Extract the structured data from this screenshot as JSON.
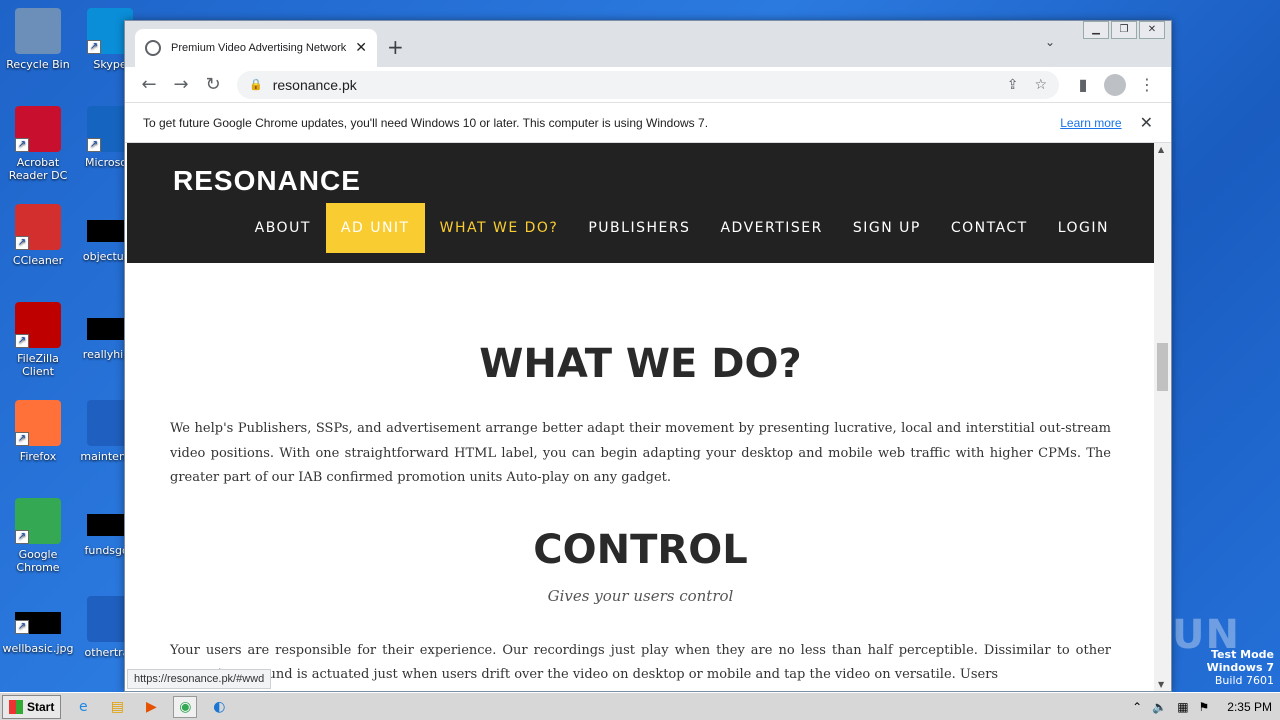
{
  "desktop": {
    "icons": [
      {
        "label": "Recycle Bin",
        "color": "#6b8fb8"
      },
      {
        "label": "Skype",
        "color": "#0a8ed8"
      },
      {
        "label": "Acrobat Reader DC",
        "color": "#c8102e"
      },
      {
        "label": "Microsoft",
        "color": "#1565c0"
      },
      {
        "label": "CCleaner",
        "color": "#d32f2f"
      },
      {
        "label": "objectunk",
        "color": "#000000"
      },
      {
        "label": "FileZilla Client",
        "color": "#bf0000"
      },
      {
        "label": "reallyhigh",
        "color": "#000000"
      },
      {
        "label": "Firefox",
        "color": "#ff7139"
      },
      {
        "label": "maintenan",
        "color": "#1f5fbf"
      },
      {
        "label": "Google Chrome",
        "color": "#34a853"
      },
      {
        "label": "fundsgoo",
        "color": "#000000"
      },
      {
        "label": "wellbasic.jpg",
        "color": "#000000"
      },
      {
        "label": "othertrac",
        "color": "#1f5fbf"
      }
    ],
    "watermark": "ANY RUN",
    "test_mode": [
      "Test Mode",
      "Windows 7",
      "Build 7601"
    ]
  },
  "browser": {
    "tab_title": "Premium Video Advertising Network",
    "url": "resonance.pk",
    "infobar_message": "To get future Google Chrome updates, you'll need Windows 10 or later. This computer is using Windows 7.",
    "infobar_link": "Learn more",
    "status_url": "https://resonance.pk/#wwd"
  },
  "site": {
    "logo": "RESONANCE",
    "menu": [
      "ABOUT",
      "AD UNIT",
      "WHAT WE DO?",
      "PUBLISHERS",
      "ADVERTISER",
      "SIGN UP",
      "CONTACT",
      "LOGIN"
    ],
    "accent": "#f9cd31",
    "section1_title": "WHAT WE DO?",
    "section1_text": "We help's Publishers, SSPs, and advertisement arrange better adapt their movement by presenting lucrative, local and interstitial out-stream video positions. With one straightforward HTML label, you can begin adapting your desktop and mobile web traffic with higher CPMs. The greater part of our IAB confirmed promotion units Auto-play on any gadget.",
    "section2_title": "CONTROL",
    "section2_sub": "Gives your users control",
    "section2_text": "Your users are responsible for their experience. Our recordings just play when they are no less than half perceptible. Dissimilar to other promotions, sound is actuated just when users drift over the video on desktop or mobile and tap the video on versatile. Users"
  },
  "taskbar": {
    "start": "Start",
    "clock": "2:35 PM"
  }
}
